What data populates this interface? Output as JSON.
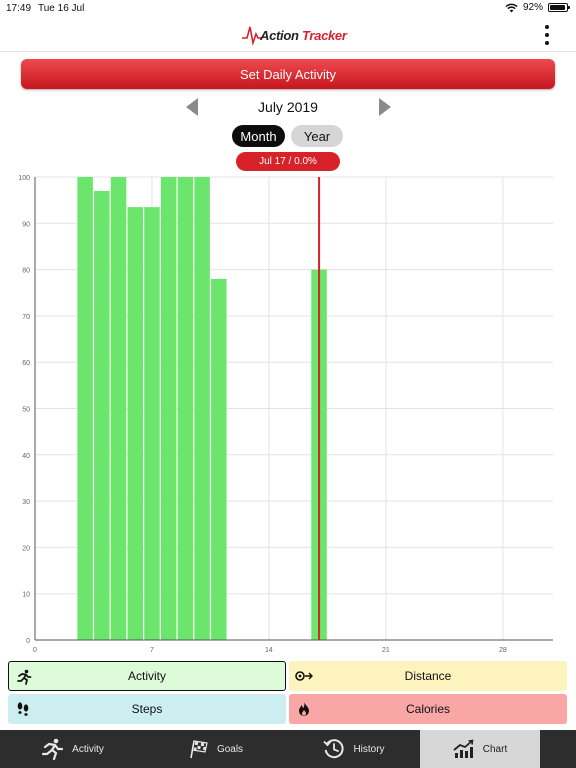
{
  "status_bar": {
    "time": "17:49",
    "date": "Tue 16 Jul",
    "battery": "92%",
    "battery_level": 0.92
  },
  "header": {
    "logo_word1": "Action",
    "logo_word2": "Tracker"
  },
  "set_button": {
    "label": "Set Daily Activity"
  },
  "month_nav": {
    "label": "July 2019"
  },
  "segments": {
    "month": "Month",
    "year": "Year",
    "selected": "Month"
  },
  "date_badge": {
    "label": "Jul 17 / 0.0%"
  },
  "chart_data": {
    "type": "bar",
    "x": [
      3,
      4,
      5,
      6,
      7,
      8,
      9,
      10,
      11,
      17
    ],
    "values": [
      100,
      97,
      100,
      93.5,
      93.5,
      100,
      100,
      100,
      78,
      80
    ],
    "xlim": [
      0,
      31
    ],
    "ylim": [
      0,
      100
    ],
    "x_ticks": [
      0,
      7,
      14,
      21,
      28
    ],
    "y_ticks": [
      0,
      10,
      20,
      30,
      40,
      50,
      60,
      70,
      80,
      90,
      100
    ],
    "marker_x": 17,
    "grid": true,
    "bar_color": "#6ce56c",
    "marker_color": "#d7222a"
  },
  "metrics": {
    "activity": "Activity",
    "distance": "Distance",
    "steps": "Steps",
    "calories": "Calories",
    "selected": "activity"
  },
  "tabs": [
    {
      "label": "Activity",
      "icon": "runner-icon"
    },
    {
      "label": "Goals",
      "icon": "checkered-flag-icon"
    },
    {
      "label": "History",
      "icon": "history-clock-icon"
    },
    {
      "label": "Chart",
      "icon": "chart-trend-icon"
    }
  ],
  "selected_tab": "Chart",
  "colors": {
    "accent_red": "#d7222a",
    "tab_bar": "#2d2d2d",
    "tab_selected": "#d7d7d7"
  }
}
